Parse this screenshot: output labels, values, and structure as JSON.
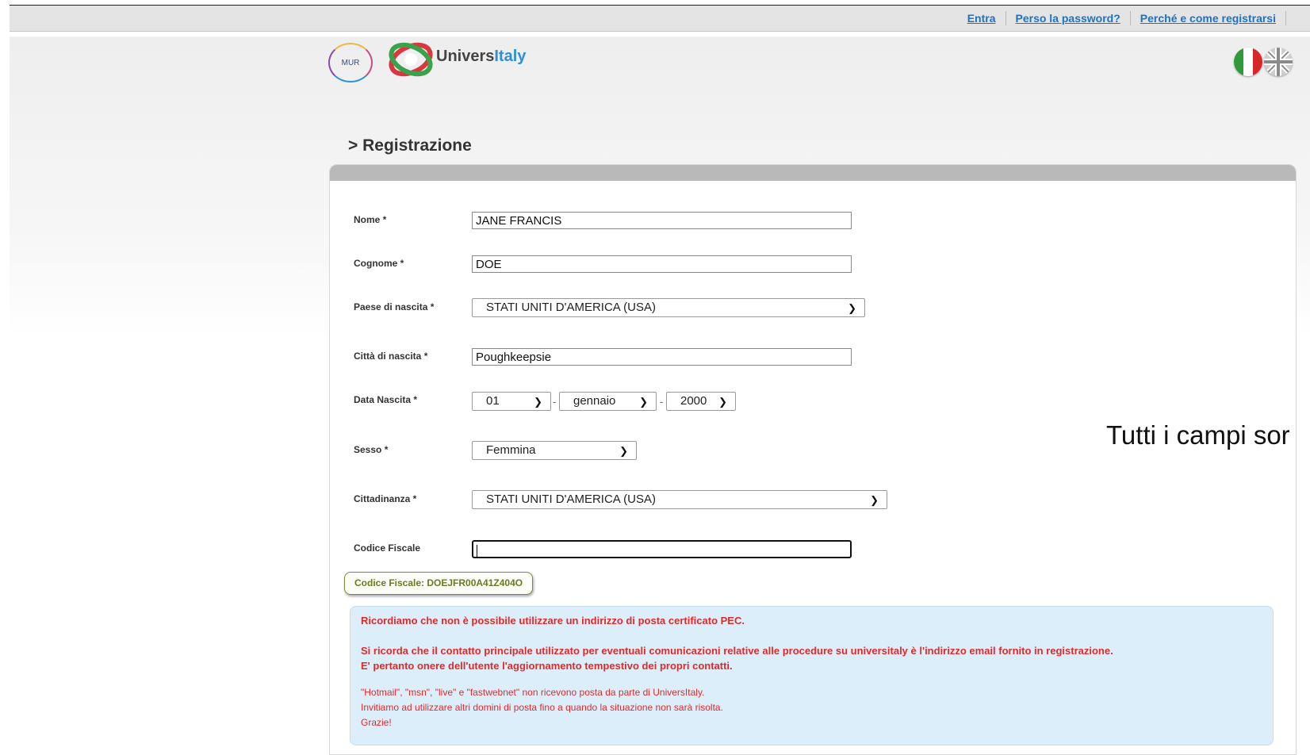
{
  "topbar": {
    "links": [
      {
        "label": "Entra"
      },
      {
        "label": "Perso la password?"
      },
      {
        "label": "Perché e come registrarsi"
      }
    ]
  },
  "branding": {
    "mur_logo": "MUR",
    "site_name_part1": "Univers",
    "site_name_part2": "Italy"
  },
  "page_title": "> Registrazione",
  "form": {
    "nome": {
      "label": "Nome *",
      "value": "JANE FRANCIS"
    },
    "cognome": {
      "label": "Cognome *",
      "value": "DOE"
    },
    "paese_nascita": {
      "label": "Paese di nascita *",
      "value": "STATI UNITI D'AMERICA (USA)"
    },
    "citta_nascita": {
      "label": "Città di nascita *",
      "value": "Poughkeepsie"
    },
    "data_nascita": {
      "label": "Data Nascita *",
      "day": "01",
      "month": "gennaio",
      "year": "2000",
      "separator": "-"
    },
    "sesso": {
      "label": "Sesso *",
      "value": "Femmina"
    },
    "cittadinanza": {
      "label": "Cittadinanza *",
      "value": "STATI UNITI D'AMERICA (USA)"
    },
    "codice_fiscale": {
      "label": "Codice Fiscale",
      "value": ""
    }
  },
  "required_note": "Tutti i campi sor",
  "codice_fiscale_badge": "Codice Fiscale:  DOEJFR00A41Z404O",
  "notice": {
    "line1": "Ricordiamo che non è possibile utilizzare un indirizzo di posta certificato PEC.",
    "line2": "Si ricorda che il contatto principale utilizzato per eventuali comunicazioni relative alle procedure su universitaly è l'indirizzo email fornito in registrazione.",
    "line3": "E' pertanto onere dell'utente l'aggiornamento tempestivo dei propri contatti.",
    "line4": "\"Hotmail\", \"msn\", \"live\" e \"fastwebnet\" non ricevono posta da parte di UniversItaly.",
    "line5": "Invitiamo ad utilizzare altri domini di posta fino a quando la situazione non sarà risolta.",
    "line6": "Grazie!"
  },
  "colors": {
    "link": "#1a73c8",
    "notice_text": "#e02a2a",
    "notice_bg": "#ddeefb",
    "badge_text": "#6b7a1e"
  },
  "icons": [
    "flag-italy-icon",
    "flag-uk-icon",
    "chevron-down-icon"
  ]
}
